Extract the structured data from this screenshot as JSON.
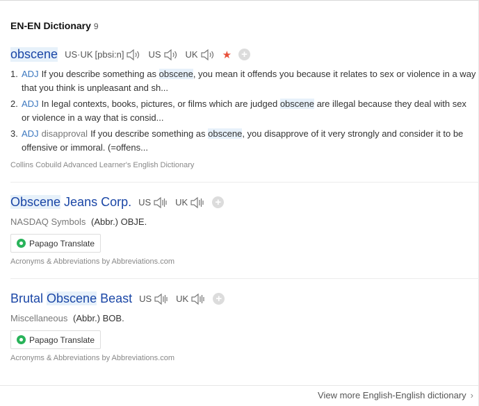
{
  "section": {
    "title": "EN-EN Dictionary",
    "count": "9"
  },
  "entries": [
    {
      "headword": "obscene",
      "pron_label": "US·UK",
      "pron": "[pbsi:n]",
      "us": "US",
      "uk": "UK",
      "definitions": [
        {
          "num": "1.",
          "pos": "ADJ",
          "pre": "If you describe something as",
          "term": "obscene",
          "post": ", you mean it offends you because it relates to sex or violence in a way that you think is unpleasant and sh..."
        },
        {
          "num": "2.",
          "pos": "ADJ",
          "pre": "In legal contexts, books, pictures, or films which are judged",
          "term": "obscene",
          "post": " are illegal because they deal with sex or violence in a way that is consid..."
        },
        {
          "num": "3.",
          "pos": "ADJ",
          "label": "disapproval",
          "pre": "If you describe something as",
          "term": "obscene",
          "post": ", you disapprove of it very strongly and consider it to be offensive or immoral. (=offens..."
        }
      ],
      "source": "Collins Cobuild Advanced Learner's English Dictionary"
    },
    {
      "hw_hl": "Obscene",
      "hw_rest": " Jeans Corp.",
      "us": "US",
      "uk": "UK",
      "category": "NASDAQ Symbols",
      "meaning": "(Abbr.) OBJE.",
      "translate": "Papago Translate",
      "source": "Acronyms & Abbreviations by Abbreviations.com"
    },
    {
      "hw_pre": "Brutal ",
      "hw_hl": "Obscene",
      "hw_rest": " Beast",
      "us": "US",
      "uk": "UK",
      "category": "Miscellaneous",
      "meaning": "(Abbr.) BOB.",
      "translate": "Papago Translate",
      "source": "Acronyms & Abbreviations by Abbreviations.com"
    }
  ],
  "footer": {
    "more_label": "View more English-English dictionary"
  },
  "icons": {
    "star": "star-icon",
    "add": "add-icon",
    "speaker": "speaker-icon",
    "papago": "papago-icon",
    "chevron": "chevron-right-icon"
  },
  "colors": {
    "headword": "#1a46a6",
    "highlight": "#e7f1fa",
    "pos": "#3b77bf",
    "star": "#e8503a",
    "papago": "#29b35a"
  }
}
